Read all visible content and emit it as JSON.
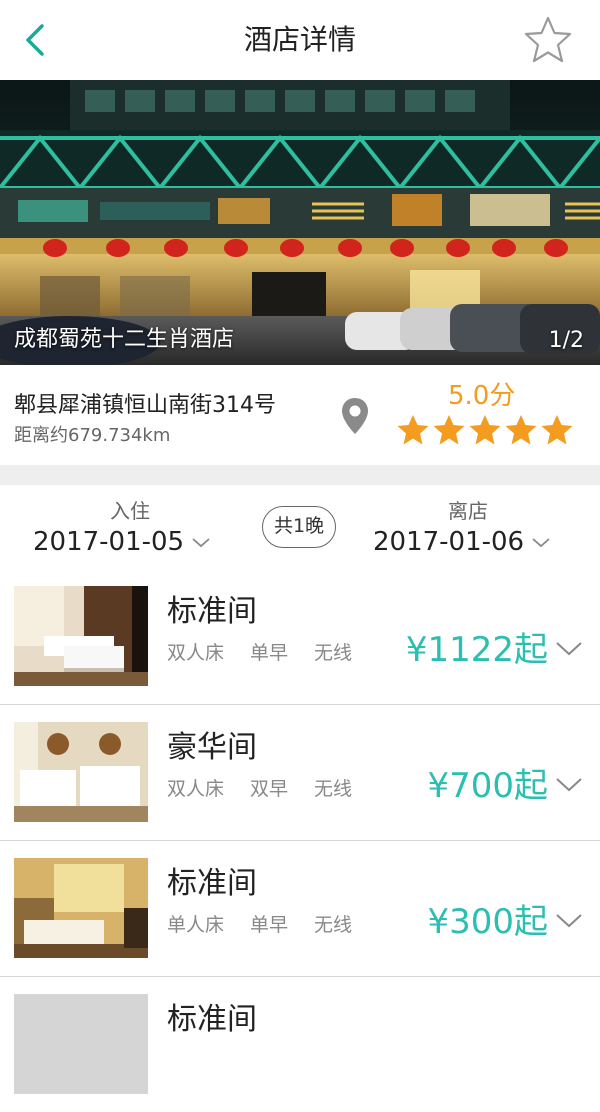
{
  "header": {
    "title": "酒店详情",
    "back_icon": "chevron-left-icon",
    "favorite_icon": "star-outline-icon",
    "accent": "#1aaa9a"
  },
  "banner": {
    "hotel_name": "成都蜀苑十二生肖酒店",
    "counter": "1/2"
  },
  "info": {
    "address": "郫县犀浦镇恒山南街314号",
    "distance": "距离约679.734km",
    "score": "5.0分",
    "stars": 5,
    "star_color": "#f39c1f"
  },
  "dates": {
    "checkin_label": "入住",
    "checkin_date": "2017-01-05",
    "nights": "共1晚",
    "checkout_label": "离店",
    "checkout_date": "2017-01-06"
  },
  "rooms": [
    {
      "name": "标准间",
      "tags": [
        "双人床",
        "单早",
        "无线"
      ],
      "price": "¥1122起"
    },
    {
      "name": "豪华间",
      "tags": [
        "双人床",
        "双早",
        "无线"
      ],
      "price": "¥700起"
    },
    {
      "name": "标准间",
      "tags": [
        "单人床",
        "单早",
        "无线"
      ],
      "price": "¥300起"
    },
    {
      "name": "标准间",
      "tags": [],
      "price": ""
    }
  ],
  "price_color": "#2cbeb0"
}
